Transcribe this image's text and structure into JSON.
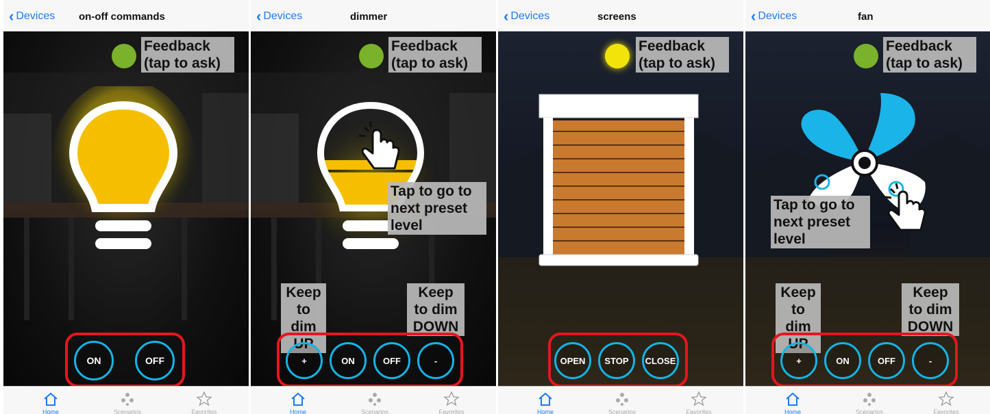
{
  "screens": [
    {
      "back_label": "Devices",
      "title": "on-off commands",
      "feedback_label": "Feedback\n(tap to ask)",
      "buttons": [
        "ON",
        "OFF"
      ]
    },
    {
      "back_label": "Devices",
      "title": "dimmer",
      "feedback_label": "Feedback\n(tap to ask)",
      "tap_label": "Tap to go to\nnext preset\nlevel",
      "keep_up_label": "Keep\nto dim\nUP",
      "keep_down_label": "Keep\nto dim\nDOWN",
      "buttons": [
        "+",
        "ON",
        "OFF",
        "-"
      ]
    },
    {
      "back_label": "Devices",
      "title": "screens",
      "feedback_label": "Feedback\n(tap to ask)",
      "buttons": [
        "OPEN",
        "STOP",
        "CLOSE"
      ]
    },
    {
      "back_label": "Devices",
      "title": "fan",
      "feedback_label": "Feedback\n(tap to ask)",
      "tap_label": "Tap to go to\nnext preset\nlevel",
      "keep_up_label": "Keep\nto dim\nUP",
      "keep_down_label": "Keep\nto dim\nDOWN",
      "buttons": [
        "+",
        "ON",
        "OFF",
        "-"
      ]
    }
  ],
  "tabbar": {
    "home": "Home",
    "scenarios": "Scenarios",
    "favorites": "Favorites"
  },
  "colors": {
    "ios_blue": "#1a7cf5",
    "button_ring": "#14b4e6",
    "frame_red": "#e8151e",
    "led_green": "#7ab22c",
    "led_yellow": "#f2e40a",
    "bulb_yellow": "#f5bf00",
    "fan_blue": "#1ab4e8"
  },
  "icons": [
    "chevron-left-icon",
    "home-icon",
    "scenarios-icon",
    "star-icon",
    "lightbulb-icon",
    "hand-tap-icon",
    "roller-shutter-icon",
    "fan-icon"
  ]
}
